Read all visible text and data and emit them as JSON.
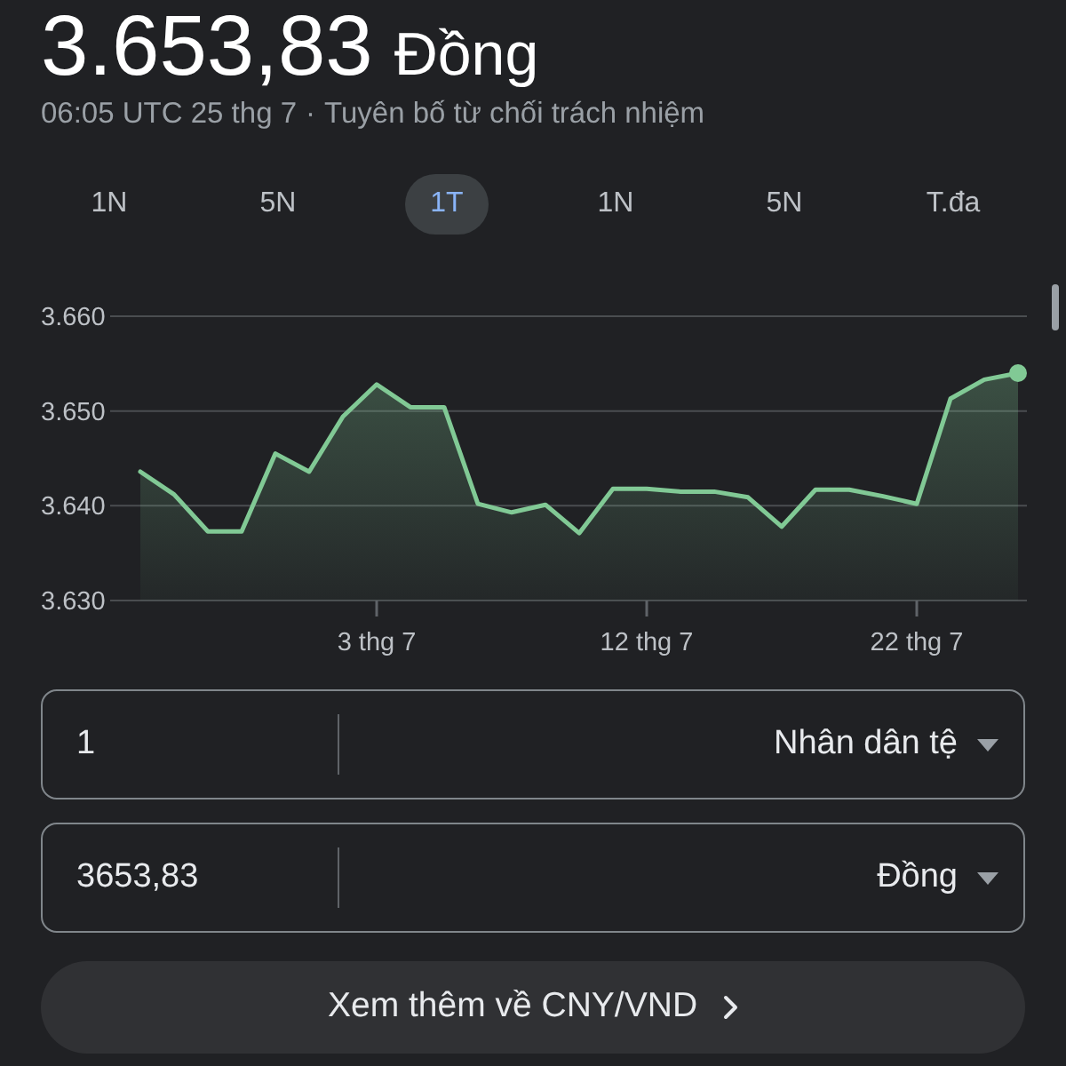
{
  "header": {
    "rate": "3.653,83",
    "currency": "Đồng"
  },
  "subtitle": {
    "updated": "06:05 UTC 25 thg 7",
    "separator": "·",
    "disclaimer": "Tuyên bố từ chối trách nhiệm"
  },
  "tabs": [
    {
      "label": "1N",
      "selected": false
    },
    {
      "label": "5N",
      "selected": false
    },
    {
      "label": "1T",
      "selected": true
    },
    {
      "label": "1N",
      "selected": false
    },
    {
      "label": "5N",
      "selected": false
    },
    {
      "label": "T.đa",
      "selected": false
    }
  ],
  "chart": {
    "chart_data": {
      "type": "area",
      "categories": [
        null,
        null,
        null,
        null,
        null,
        null,
        null,
        "3 thg 7",
        null,
        null,
        null,
        null,
        null,
        null,
        null,
        "12 thg 7",
        null,
        null,
        null,
        null,
        null,
        null,
        null,
        "22 thg 7",
        null,
        null,
        null
      ],
      "series": [
        {
          "color": "#81c995",
          "values": [
            3643.6,
            3641.2,
            3637.3,
            3637.3,
            3645.5,
            3643.6,
            3649.4,
            3652.8,
            3650.4,
            3650.4,
            3640.2,
            3639.3,
            3640.1,
            3637.1,
            3641.8,
            3641.8,
            3641.5,
            3641.5,
            3640.9,
            3637.8,
            3641.7,
            3641.7,
            3641,
            3640.2,
            3651.3,
            3653.3,
            3654
          ]
        }
      ],
      "ylim": [
        3630,
        3660
      ],
      "yticks": [
        {
          "value": 3630,
          "label": "3.630"
        },
        {
          "value": 3640,
          "label": "3.640"
        },
        {
          "value": 3650,
          "label": "3.650"
        },
        {
          "value": 3660,
          "label": "3.660"
        }
      ]
    }
  },
  "converter": [
    {
      "amount": "1",
      "currency": "Nhân dân tệ"
    },
    {
      "amount": "3653,83",
      "currency": "Đồng"
    }
  ],
  "more_button": {
    "label": "Xem thêm về CNY/VND"
  }
}
